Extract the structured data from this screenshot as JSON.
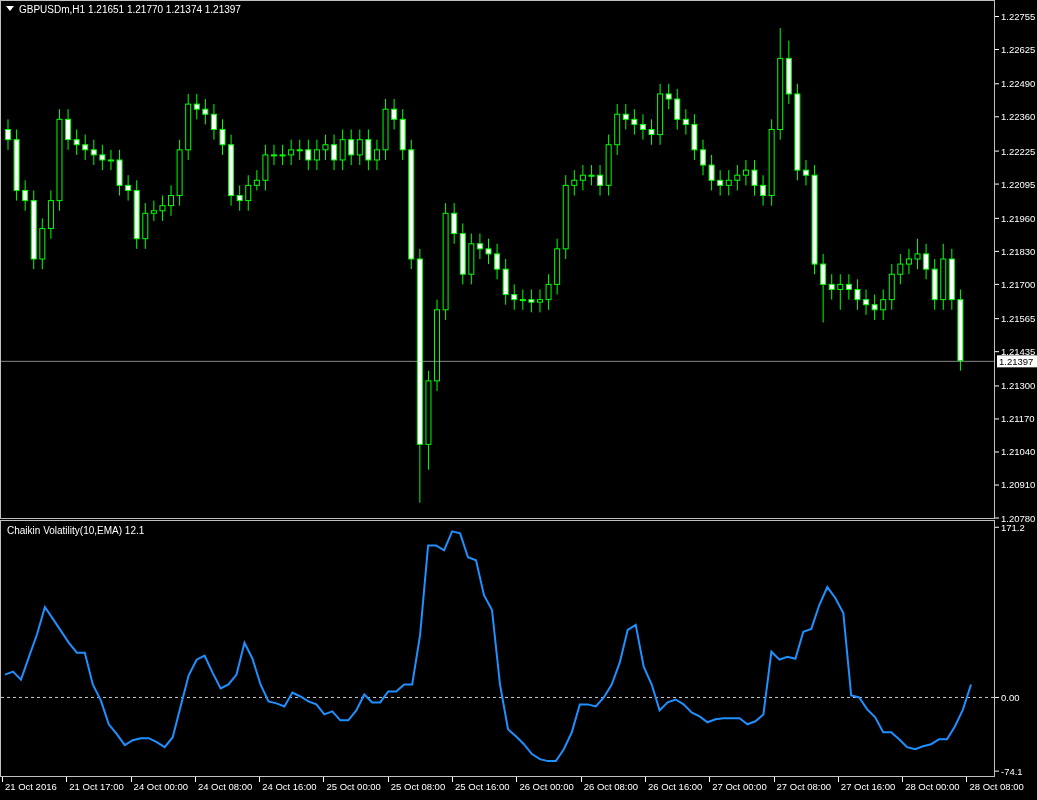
{
  "main_chart": {
    "symbol": "GBPUSDm,H1",
    "quote": "1.21651 1.21770 1.21374 1.21397",
    "chart_data": {
      "type": "candlestick",
      "ylim": [
        1.2078,
        1.2282
      ],
      "ref_lines": [
        {
          "axis": "y",
          "value": 1.21397,
          "label": "1.21397",
          "color": "#c0c0c0"
        }
      ],
      "yticks": [
        {
          "value": 1.22755,
          "label": "1.22755"
        },
        {
          "value": 1.22625,
          "label": "1.22625"
        },
        {
          "value": 1.2249,
          "label": "1.22490"
        },
        {
          "value": 1.2236,
          "label": "1.22360"
        },
        {
          "value": 1.22225,
          "label": "1.22225"
        },
        {
          "value": 1.22095,
          "label": "1.22095"
        },
        {
          "value": 1.2196,
          "label": "1.21960"
        },
        {
          "value": 1.2183,
          "label": "1.21830"
        },
        {
          "value": 1.217,
          "label": "1.21700"
        },
        {
          "value": 1.21565,
          "label": "1.21565"
        },
        {
          "value": 1.21435,
          "label": "1.21435"
        },
        {
          "value": 1.213,
          "label": "1.21300"
        },
        {
          "value": 1.2117,
          "label": "1.21170"
        },
        {
          "value": 1.2104,
          "label": "1.21040"
        },
        {
          "value": 1.2091,
          "label": "1.20910"
        },
        {
          "value": 1.2078,
          "label": "1.20780"
        }
      ],
      "ohlc": [
        [
          1.2231,
          1.2235,
          1.2223,
          1.2227
        ],
        [
          1.2227,
          1.2231,
          1.2203,
          1.2207
        ],
        [
          1.2207,
          1.2211,
          1.2199,
          1.2203
        ],
        [
          1.2203,
          1.2207,
          1.2176,
          1.218
        ],
        [
          1.218,
          1.2196,
          1.2176,
          1.2192
        ],
        [
          1.2192,
          1.2207,
          1.2188,
          1.2203
        ],
        [
          1.2203,
          1.2239,
          1.2199,
          1.2235
        ],
        [
          1.2235,
          1.2239,
          1.2223,
          1.2227
        ],
        [
          1.2227,
          1.2231,
          1.2221,
          1.2225
        ],
        [
          1.2225,
          1.2229,
          1.2219,
          1.2223
        ],
        [
          1.2223,
          1.2227,
          1.2217,
          1.2221
        ],
        [
          1.2221,
          1.2225,
          1.2215,
          1.2219
        ],
        [
          1.2219,
          1.2223,
          1.2215,
          1.2219
        ],
        [
          1.2219,
          1.2223,
          1.2205,
          1.2209
        ],
        [
          1.2209,
          1.2213,
          1.2203,
          1.2207
        ],
        [
          1.2207,
          1.2211,
          1.2184,
          1.2188
        ],
        [
          1.2188,
          1.2202,
          1.2184,
          1.2198
        ],
        [
          1.2198,
          1.2203,
          1.2195,
          1.2199
        ],
        [
          1.2199,
          1.2205,
          1.2195,
          1.2201
        ],
        [
          1.2201,
          1.2209,
          1.2197,
          1.2205
        ],
        [
          1.2205,
          1.2227,
          1.2201,
          1.2223
        ],
        [
          1.2223,
          1.2245,
          1.2219,
          1.2241
        ],
        [
          1.2241,
          1.2245,
          1.2235,
          1.2239
        ],
        [
          1.2239,
          1.2243,
          1.2233,
          1.2237
        ],
        [
          1.2237,
          1.2241,
          1.2227,
          1.2231
        ],
        [
          1.2231,
          1.2235,
          1.2221,
          1.2225
        ],
        [
          1.2225,
          1.2229,
          1.2201,
          1.2205
        ],
        [
          1.2205,
          1.2209,
          1.2199,
          1.2203
        ],
        [
          1.2203,
          1.2213,
          1.2199,
          1.2209
        ],
        [
          1.2209,
          1.2215,
          1.2207,
          1.2211
        ],
        [
          1.2211,
          1.2225,
          1.2207,
          1.2221
        ],
        [
          1.2221,
          1.2225,
          1.2217,
          1.2221
        ],
        [
          1.2221,
          1.2225,
          1.2217,
          1.2221
        ],
        [
          1.2221,
          1.2227,
          1.2217,
          1.2223
        ],
        [
          1.2223,
          1.2227,
          1.2219,
          1.2223
        ],
        [
          1.2223,
          1.2227,
          1.2215,
          1.2219
        ],
        [
          1.2219,
          1.2227,
          1.2215,
          1.2223
        ],
        [
          1.2223,
          1.2229,
          1.2219,
          1.2225
        ],
        [
          1.2225,
          1.2229,
          1.2215,
          1.2219
        ],
        [
          1.2219,
          1.2231,
          1.2215,
          1.2227
        ],
        [
          1.2227,
          1.2231,
          1.2217,
          1.2221
        ],
        [
          1.2221,
          1.2231,
          1.2217,
          1.2227
        ],
        [
          1.2227,
          1.2231,
          1.2215,
          1.2219
        ],
        [
          1.2219,
          1.2227,
          1.2215,
          1.2223
        ],
        [
          1.2223,
          1.2243,
          1.2219,
          1.2239
        ],
        [
          1.2239,
          1.2243,
          1.2231,
          1.2235
        ],
        [
          1.2235,
          1.2239,
          1.2219,
          1.2223
        ],
        [
          1.2223,
          1.2227,
          1.2176,
          1.218
        ],
        [
          1.218,
          1.2184,
          1.2084,
          1.2107
        ],
        [
          1.2107,
          1.2136,
          1.2097,
          1.2132
        ],
        [
          1.2132,
          1.2164,
          1.2128,
          1.216
        ],
        [
          1.216,
          1.2202,
          1.2156,
          1.2198
        ],
        [
          1.2198,
          1.2202,
          1.2186,
          1.219
        ],
        [
          1.219,
          1.2194,
          1.217,
          1.2174
        ],
        [
          1.2174,
          1.219,
          1.217,
          1.2186
        ],
        [
          1.2186,
          1.219,
          1.218,
          1.2184
        ],
        [
          1.2184,
          1.2188,
          1.2178,
          1.2182
        ],
        [
          1.2182,
          1.2186,
          1.2172,
          1.2176
        ],
        [
          1.2176,
          1.218,
          1.2162,
          1.2166
        ],
        [
          1.2166,
          1.217,
          1.216,
          1.2164
        ],
        [
          1.2164,
          1.2168,
          1.216,
          1.2164
        ],
        [
          1.2164,
          1.2168,
          1.2159,
          1.2163
        ],
        [
          1.2163,
          1.2168,
          1.2159,
          1.2164
        ],
        [
          1.2164,
          1.2174,
          1.216,
          1.217
        ],
        [
          1.217,
          1.2188,
          1.2166,
          1.2184
        ],
        [
          1.2184,
          1.2213,
          1.218,
          1.2209
        ],
        [
          1.2209,
          1.2215,
          1.2205,
          1.2211
        ],
        [
          1.2211,
          1.2217,
          1.2207,
          1.2213
        ],
        [
          1.2213,
          1.2217,
          1.2209,
          1.2213
        ],
        [
          1.2213,
          1.2217,
          1.2205,
          1.2209
        ],
        [
          1.2209,
          1.2229,
          1.2205,
          1.2225
        ],
        [
          1.2225,
          1.2241,
          1.2221,
          1.2237
        ],
        [
          1.2237,
          1.2241,
          1.2231,
          1.2235
        ],
        [
          1.2235,
          1.2239,
          1.2229,
          1.2233
        ],
        [
          1.2233,
          1.2237,
          1.2227,
          1.2231
        ],
        [
          1.2231,
          1.2235,
          1.2225,
          1.2229
        ],
        [
          1.2229,
          1.2249,
          1.2225,
          1.2245
        ],
        [
          1.2245,
          1.2249,
          1.2239,
          1.2243
        ],
        [
          1.2243,
          1.2247,
          1.2231,
          1.2235
        ],
        [
          1.2235,
          1.2239,
          1.2229,
          1.2233
        ],
        [
          1.2233,
          1.2237,
          1.2219,
          1.2223
        ],
        [
          1.2223,
          1.2227,
          1.2213,
          1.2217
        ],
        [
          1.2217,
          1.2221,
          1.2207,
          1.2211
        ],
        [
          1.2211,
          1.2215,
          1.2205,
          1.2209
        ],
        [
          1.2209,
          1.2215,
          1.2205,
          1.2211
        ],
        [
          1.2211,
          1.2217,
          1.2207,
          1.2213
        ],
        [
          1.2213,
          1.2219,
          1.2209,
          1.2215
        ],
        [
          1.2215,
          1.2219,
          1.2205,
          1.2209
        ],
        [
          1.2209,
          1.2213,
          1.2201,
          1.2205
        ],
        [
          1.2205,
          1.2235,
          1.2201,
          1.2231
        ],
        [
          1.2231,
          1.2271,
          1.2227,
          1.2259
        ],
        [
          1.2259,
          1.2266,
          1.2241,
          1.2245
        ],
        [
          1.2245,
          1.2249,
          1.2211,
          1.2215
        ],
        [
          1.2215,
          1.2219,
          1.2209,
          1.2213
        ],
        [
          1.2213,
          1.2217,
          1.2174,
          1.2178
        ],
        [
          1.2178,
          1.2182,
          1.2155,
          1.217
        ],
        [
          1.217,
          1.2174,
          1.2164,
          1.2168
        ],
        [
          1.2168,
          1.2174,
          1.216,
          1.217
        ],
        [
          1.217,
          1.2174,
          1.2164,
          1.2168
        ],
        [
          1.2168,
          1.2172,
          1.216,
          1.2164
        ],
        [
          1.2164,
          1.2168,
          1.2158,
          1.2162
        ],
        [
          1.2162,
          1.2166,
          1.2156,
          1.216
        ],
        [
          1.216,
          1.2168,
          1.2156,
          1.2164
        ],
        [
          1.2164,
          1.2178,
          1.216,
          1.2174
        ],
        [
          1.2174,
          1.2182,
          1.217,
          1.2178
        ],
        [
          1.2178,
          1.2184,
          1.2174,
          1.218
        ],
        [
          1.218,
          1.2188,
          1.2176,
          1.2182
        ],
        [
          1.2182,
          1.2186,
          1.2172,
          1.2176
        ],
        [
          1.2176,
          1.218,
          1.216,
          1.2164
        ],
        [
          1.2164,
          1.2186,
          1.216,
          1.218
        ],
        [
          1.218,
          1.2184,
          1.216,
          1.2164
        ],
        [
          1.2164,
          1.2168,
          1.2136,
          1.214
        ]
      ]
    }
  },
  "indicator": {
    "title": "Chaikin Volatility(10,EMA) 12.1",
    "chart_data": {
      "type": "line",
      "ylim": [
        -80,
        178.5
      ],
      "yticks": [
        {
          "value": 171.2,
          "label": "171.2"
        },
        {
          "value": 0,
          "label": "0.00"
        },
        {
          "value": -74.1,
          "label": "-74.1"
        }
      ],
      "series": [
        {
          "color": "#1e90ff",
          "values": [
            23,
            26,
            18,
            41,
            63,
            91,
            79,
            67,
            55,
            45,
            45,
            13,
            -3,
            -27,
            -37,
            -48,
            -43,
            -41,
            -41,
            -45,
            -50,
            -40,
            -9,
            22,
            38,
            42,
            25,
            9,
            13,
            23,
            55,
            39,
            13,
            -4,
            -6,
            -9,
            5,
            1,
            -4,
            -7,
            -17,
            -14,
            -23,
            -23,
            -13,
            3,
            -5,
            -5,
            6,
            6,
            13,
            13,
            63,
            153,
            153,
            148,
            167,
            165,
            141,
            138,
            103,
            88,
            13,
            -32,
            -39,
            -47,
            -57,
            -62,
            -64,
            -64,
            -52,
            -35,
            -7,
            -7,
            -9,
            0,
            13,
            35,
            68,
            73,
            31,
            13,
            -13,
            -5,
            -2,
            -7,
            -15,
            -19,
            -25,
            -22,
            -21,
            -21,
            -21,
            -27,
            -24,
            -17,
            46,
            38,
            41,
            39,
            66,
            69,
            93,
            111,
            100,
            85,
            2,
            0,
            -12,
            -20,
            -35,
            -35,
            -42,
            -50,
            -52,
            -49,
            -47,
            -42,
            -42,
            -29,
            -12,
            13
          ]
        }
      ]
    }
  },
  "time_axis": [
    "21 Oct 2016",
    "21 Oct 17:00",
    "24 Oct 00:00",
    "24 Oct 08:00",
    "24 Oct 16:00",
    "25 Oct 00:00",
    "25 Oct 08:00",
    "25 Oct 16:00",
    "26 Oct 00:00",
    "26 Oct 08:00",
    "26 Oct 16:00",
    "27 Oct 00:00",
    "27 Oct 08:00",
    "27 Oct 16:00",
    "28 Oct 00:00",
    "28 Oct 08:00"
  ]
}
